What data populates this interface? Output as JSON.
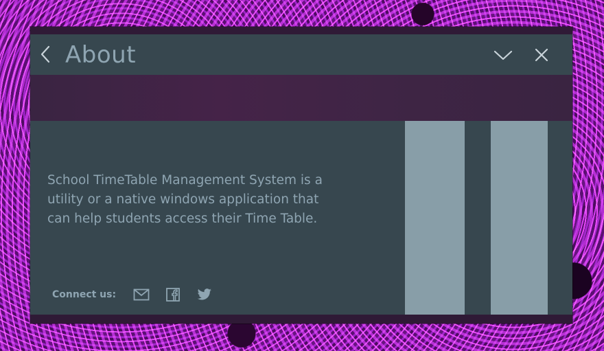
{
  "window": {
    "title": "About"
  },
  "about": {
    "description": "School TimeTable Management System is a utility or a native windows application that can help students access their Time Table."
  },
  "connect": {
    "label": "Connect us:",
    "icons": [
      "mail-icon",
      "facebook-icon",
      "twitter-icon"
    ]
  },
  "colors": {
    "titlebar": "#37474f",
    "text": "#8fa5b2",
    "panel": "#889ea8",
    "banner": "#452348"
  }
}
